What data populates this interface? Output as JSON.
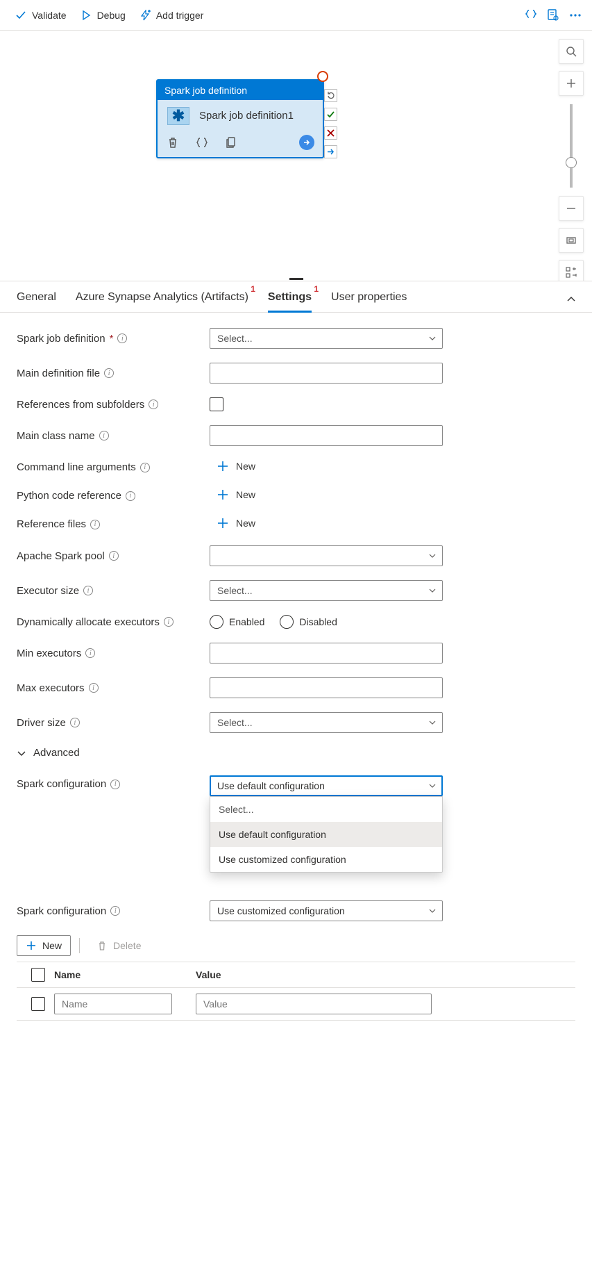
{
  "toolbar": {
    "validate": "Validate",
    "debug": "Debug",
    "add_trigger": "Add trigger"
  },
  "canvas": {
    "activity": {
      "type_label": "Spark job definition",
      "name": "Spark job definition1"
    }
  },
  "tabs": {
    "general": "General",
    "artifacts": "Azure Synapse Analytics (Artifacts)",
    "artifacts_badge": "1",
    "settings": "Settings",
    "settings_badge": "1",
    "user_properties": "User properties"
  },
  "form": {
    "spark_job_def_label": "Spark job definition",
    "spark_job_def_placeholder": "Select...",
    "main_def_file_label": "Main definition file",
    "ref_subfolders_label": "References from subfolders",
    "main_class_label": "Main class name",
    "cmd_args_label": "Command line arguments",
    "py_ref_label": "Python code reference",
    "ref_files_label": "Reference files",
    "add_new": "New",
    "spark_pool_label": "Apache Spark pool",
    "executor_size_label": "Executor size",
    "executor_size_placeholder": "Select...",
    "dyn_exec_label": "Dynamically allocate executors",
    "enabled": "Enabled",
    "disabled": "Disabled",
    "min_exec_label": "Min executors",
    "max_exec_label": "Max executors",
    "driver_size_label": "Driver size",
    "driver_size_placeholder": "Select...",
    "advanced": "Advanced",
    "spark_config_label": "Spark configuration",
    "spark_config_value": "Use default configuration",
    "spark_config_opts": {
      "placeholder": "Select...",
      "default": "Use default configuration",
      "custom": "Use customized configuration"
    },
    "spark_config2_value": "Use customized configuration",
    "table": {
      "new": "New",
      "delete": "Delete",
      "col_name": "Name",
      "col_value": "Value",
      "name_placeholder": "Name",
      "value_placeholder": "Value"
    }
  }
}
